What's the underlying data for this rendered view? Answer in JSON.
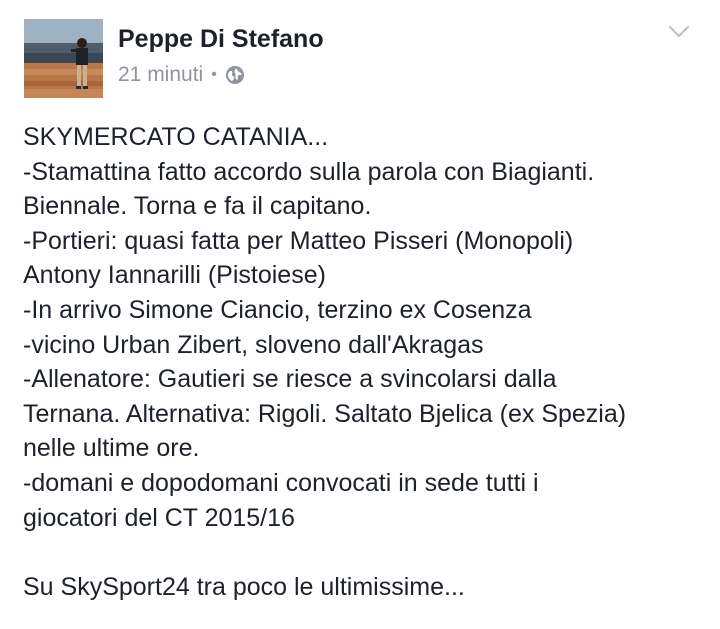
{
  "post": {
    "author": "Peppe Di Stefano",
    "timestamp": "21 minuti",
    "separator": "•",
    "privacy_icon": "globe-icon",
    "menu_icon": "chevron-down-icon",
    "lines": [
      "SKYMERCATO CATANIA...",
      "-Stamattina fatto accordo sulla parola con Biagianti.",
      "Biennale. Torna e fa il capitano.",
      "-Portieri: quasi fatta per Matteo Pisseri (Monopoli)",
      "Antony Iannarilli (Pistoiese)",
      "-In arrivo Simone Ciancio, terzino ex Cosenza",
      "-vicino Urban Zibert, sloveno dall'Akragas",
      "-Allenatore: Gautieri se riesce a svincolarsi dalla",
      "Ternana. Alternativa: Rigoli. Saltato Bjelica (ex Spezia)",
      "nelle ultime ore.",
      "-domani e dopodomani convocati in sede tutti i",
      "giocatori del CT 2015/16",
      "",
      "Su SkySport24 tra poco le ultimissime..."
    ]
  },
  "colors": {
    "text": "#1d2129",
    "meta": "#90949c",
    "chevron": "#bec2c9",
    "background": "#ffffff"
  }
}
